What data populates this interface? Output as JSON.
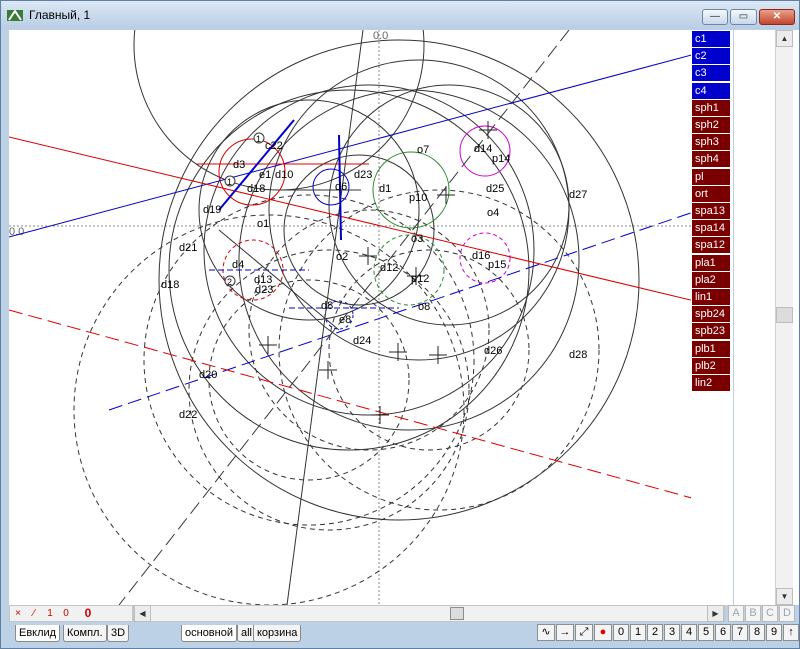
{
  "window": {
    "title": "Главный, 1"
  },
  "canvas": {
    "axis_labels": {
      "x_origin": "0.0",
      "top_origin": "0.0"
    },
    "labels": [
      "c22",
      "d3",
      "d4",
      "d19",
      "d21",
      "d18",
      "d20",
      "d22",
      "d23",
      "d25",
      "d27",
      "d26",
      "d28",
      "d24",
      "d12",
      "d14",
      "d16",
      "o1",
      "o2",
      "o3",
      "o4",
      "o7",
      "o8",
      "p10",
      "p12",
      "p14",
      "p15",
      "d6",
      "d8",
      "e8",
      "e9",
      "e1",
      "1",
      "2"
    ]
  },
  "legend": {
    "items": [
      {
        "label": "c1",
        "color": "#0000cc"
      },
      {
        "label": "c2",
        "color": "#0000cc"
      },
      {
        "label": "c3",
        "color": "#0000cc"
      },
      {
        "label": "c4",
        "color": "#0000cc"
      },
      {
        "label": "sph1",
        "color": "#7a0000"
      },
      {
        "label": "sph2",
        "color": "#7a0000"
      },
      {
        "label": "sph3",
        "color": "#7a0000"
      },
      {
        "label": "sph4",
        "color": "#7a0000"
      },
      {
        "label": "pl",
        "color": "#7a0000"
      },
      {
        "label": "ort",
        "color": "#7a0000"
      },
      {
        "label": "spa13",
        "color": "#7a0000"
      },
      {
        "label": "spa14",
        "color": "#7a0000"
      },
      {
        "label": "spa12",
        "color": "#7a0000"
      },
      {
        "label": "pla1",
        "color": "#7a0000"
      },
      {
        "label": "pla2",
        "color": "#7a0000"
      },
      {
        "label": "lin1",
        "color": "#7a0000"
      },
      {
        "label": "spb24",
        "color": "#7a0000"
      },
      {
        "label": "spb23",
        "color": "#7a0000"
      },
      {
        "label": "plb1",
        "color": "#7a0000"
      },
      {
        "label": "plb2",
        "color": "#7a0000"
      },
      {
        "label": "lin2",
        "color": "#7a0000"
      }
    ]
  },
  "toolbar": {
    "tools": [
      "×",
      "∕",
      "1",
      "0",
      "0"
    ]
  },
  "abcd": [
    "A",
    "B",
    "C",
    "D"
  ],
  "tabs": {
    "left": [
      "Евклид",
      "Компл.",
      "3D"
    ],
    "layers": [
      "основной",
      "all",
      "корзина"
    ]
  },
  "bottom_buttons": {
    "icons": [
      "pen-icon",
      "arrow-right-icon",
      "diagonal-arrow-icon",
      "record-dot-icon"
    ],
    "numbers": [
      "0",
      "1",
      "2",
      "3",
      "4",
      "5",
      "6",
      "7",
      "8",
      "9",
      "↑"
    ]
  }
}
